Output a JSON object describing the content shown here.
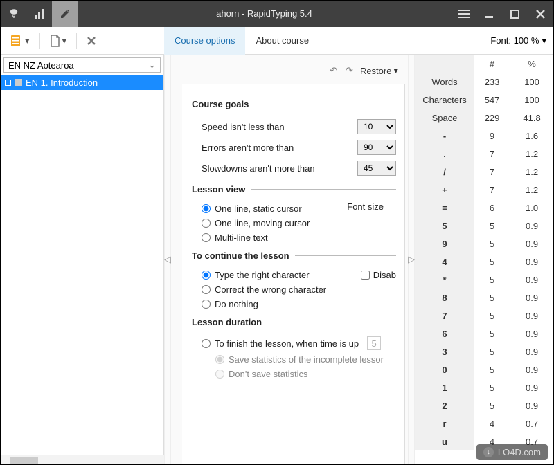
{
  "title": "ahorn - RapidTyping 5.4",
  "sidebar": {
    "language": "EN NZ Aotearoa",
    "tree_item": "EN 1. Introduction"
  },
  "tabs": {
    "course_options": "Course options",
    "about_course": "About course"
  },
  "font_zoom": "Font: 100 %",
  "restore": "Restore",
  "sections": {
    "course_goals": "Course goals",
    "lesson_view": "Lesson view",
    "continue": "To continue the lesson",
    "duration": "Lesson duration"
  },
  "goals": {
    "speed_label": "Speed isn't less than",
    "speed_value": "10",
    "errors_label": "Errors aren't more than",
    "errors_value": "90",
    "slowdowns_label": "Slowdowns aren't more than",
    "slowdowns_value": "45"
  },
  "lesson_view": {
    "static": "One line, static cursor",
    "moving": "One line, moving cursor",
    "multi": "Multi-line text",
    "font_size": "Font size"
  },
  "continue": {
    "right": "Type the right character",
    "correct": "Correct the wrong character",
    "nothing": "Do nothing",
    "disable": "Disab"
  },
  "duration": {
    "finish": "To finish the lesson, when time is up",
    "finish_val": "5",
    "save": "Save statistics of the incomplete lessor",
    "nosave": "Don't save statistics"
  },
  "stats": {
    "headers": {
      "count": "#",
      "percent": "%"
    },
    "rows": [
      {
        "k": "Words",
        "n": "233",
        "p": "100"
      },
      {
        "k": "Characters",
        "n": "547",
        "p": "100"
      },
      {
        "k": "Space",
        "n": "229",
        "p": "41.8"
      },
      {
        "k": "-",
        "n": "9",
        "p": "1.6"
      },
      {
        "k": ".",
        "n": "7",
        "p": "1.2"
      },
      {
        "k": "/",
        "n": "7",
        "p": "1.2"
      },
      {
        "k": "+",
        "n": "7",
        "p": "1.2"
      },
      {
        "k": "=",
        "n": "6",
        "p": "1.0"
      },
      {
        "k": "5",
        "n": "5",
        "p": "0.9"
      },
      {
        "k": "9",
        "n": "5",
        "p": "0.9"
      },
      {
        "k": "4",
        "n": "5",
        "p": "0.9"
      },
      {
        "k": "*",
        "n": "5",
        "p": "0.9"
      },
      {
        "k": "8",
        "n": "5",
        "p": "0.9"
      },
      {
        "k": "7",
        "n": "5",
        "p": "0.9"
      },
      {
        "k": "6",
        "n": "5",
        "p": "0.9"
      },
      {
        "k": "3",
        "n": "5",
        "p": "0.9"
      },
      {
        "k": "0",
        "n": "5",
        "p": "0.9"
      },
      {
        "k": "1",
        "n": "5",
        "p": "0.9"
      },
      {
        "k": "2",
        "n": "5",
        "p": "0.9"
      },
      {
        "k": "r",
        "n": "4",
        "p": "0.7"
      },
      {
        "k": "u",
        "n": "4",
        "p": "0.7"
      }
    ]
  },
  "watermark": "LO4D.com"
}
